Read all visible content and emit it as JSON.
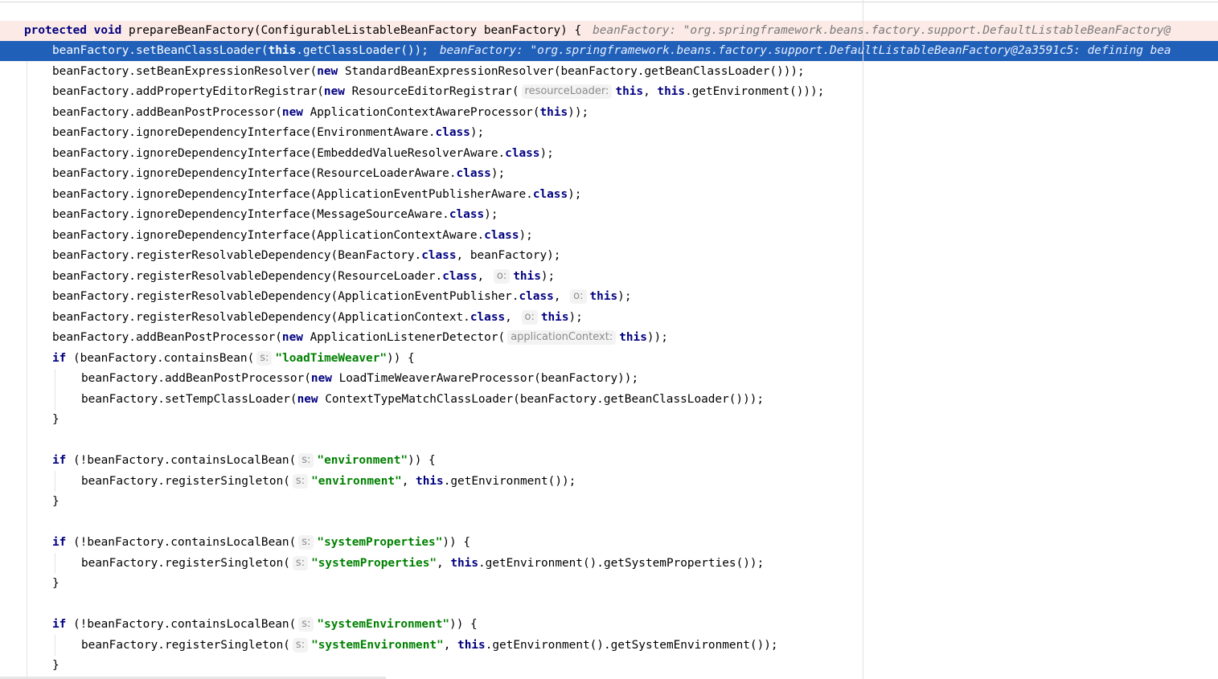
{
  "editor": {
    "method_signature": {
      "kw_protected": "protected",
      "kw_void": "void",
      "text": " prepareBeanFactory(ConfigurableListableBeanFactory beanFactory) {",
      "inline_value": "beanFactory: \"org.springframework.beans.factory.support.DefaultListableBeanFactory@"
    },
    "lines": {
      "l1": {
        "a": "beanFactory.setBeanClassLoader(",
        "kw1": "this",
        "b": ".getClassLoader());",
        "inline_value": "beanFactory: \"org.springframework.beans.factory.support.DefaultListableBeanFactory@2a3591c5: defining bea"
      },
      "l2": {
        "a": "beanFactory.setBeanExpressionResolver(",
        "kw1": "new",
        "b": " StandardBeanExpressionResolver(beanFactory.getBeanClassLoader()));"
      },
      "l3": {
        "a": "beanFactory.addPropertyEditorRegistrar(",
        "kw1": "new",
        "b": " ResourceEditorRegistrar(",
        "hint": "resourceLoader:",
        "kw2": "this",
        "c": ", ",
        "kw3": "this",
        "d": ".getEnvironment()));"
      },
      "l4": {
        "a": "beanFactory.addBeanPostProcessor(",
        "kw1": "new",
        "b": " ApplicationContextAwareProcessor(",
        "kw2": "this",
        "c": "));"
      },
      "l5": {
        "a": "beanFactory.ignoreDependencyInterface(EnvironmentAware.",
        "kw1": "class",
        "b": ");"
      },
      "l6": {
        "a": "beanFactory.ignoreDependencyInterface(EmbeddedValueResolverAware.",
        "kw1": "class",
        "b": ");"
      },
      "l7": {
        "a": "beanFactory.ignoreDependencyInterface(ResourceLoaderAware.",
        "kw1": "class",
        "b": ");"
      },
      "l8": {
        "a": "beanFactory.ignoreDependencyInterface(ApplicationEventPublisherAware.",
        "kw1": "class",
        "b": ");"
      },
      "l9": {
        "a": "beanFactory.ignoreDependencyInterface(MessageSourceAware.",
        "kw1": "class",
        "b": ");"
      },
      "l10": {
        "a": "beanFactory.ignoreDependencyInterface(ApplicationContextAware.",
        "kw1": "class",
        "b": ");"
      },
      "l11": {
        "a": "beanFactory.registerResolvableDependency(BeanFactory.",
        "kw1": "class",
        "b": ", beanFactory);"
      },
      "l12": {
        "a": "beanFactory.registerResolvableDependency(ResourceLoader.",
        "kw1": "class",
        "b": ",",
        "hint": "o:",
        "kw2": "this",
        "c": ");"
      },
      "l13": {
        "a": "beanFactory.registerResolvableDependency(ApplicationEventPublisher.",
        "kw1": "class",
        "b": ",",
        "hint": "o:",
        "kw2": "this",
        "c": ");"
      },
      "l14": {
        "a": "beanFactory.registerResolvableDependency(ApplicationContext.",
        "kw1": "class",
        "b": ",",
        "hint": "o:",
        "kw2": "this",
        "c": ");"
      },
      "l15": {
        "a": "beanFactory.addBeanPostProcessor(",
        "kw1": "new",
        "b": " ApplicationListenerDetector(",
        "hint": "applicationContext:",
        "kw2": "this",
        "c": "));"
      },
      "l16": {
        "kw1": "if",
        "a": " (beanFactory.containsBean(",
        "hint": "s:",
        "str": "\"loadTimeWeaver\"",
        "b": ")) {"
      },
      "l17": {
        "a": "beanFactory.addBeanPostProcessor(",
        "kw1": "new",
        "b": " LoadTimeWeaverAwareProcessor(beanFactory));"
      },
      "l18": {
        "a": "beanFactory.setTempClassLoader(",
        "kw1": "new",
        "b": " ContextTypeMatchClassLoader(beanFactory.getBeanClassLoader()));"
      },
      "l19": {
        "a": "}"
      },
      "l21": {
        "kw1": "if",
        "a": " (!beanFactory.containsLocalBean(",
        "hint": "s:",
        "str": "\"environment\"",
        "b": ")) {"
      },
      "l22": {
        "a": "beanFactory.registerSingleton(",
        "hint": "s:",
        "str": "\"environment\"",
        "b": ", ",
        "kw1": "this",
        "c": ".getEnvironment());"
      },
      "l23": {
        "a": "}"
      },
      "l25": {
        "kw1": "if",
        "a": " (!beanFactory.containsLocalBean(",
        "hint": "s:",
        "str": "\"systemProperties\"",
        "b": ")) {"
      },
      "l26": {
        "a": "beanFactory.registerSingleton(",
        "hint": "s:",
        "str": "\"systemProperties\"",
        "b": ", ",
        "kw1": "this",
        "c": ".getEnvironment().getSystemProperties());"
      },
      "l27": {
        "a": "}"
      },
      "l29": {
        "kw1": "if",
        "a": " (!beanFactory.containsLocalBean(",
        "hint": "s:",
        "str": "\"systemEnvironment\"",
        "b": ")) {"
      },
      "l30": {
        "a": "beanFactory.registerSingleton(",
        "hint": "s:",
        "str": "\"systemEnvironment\"",
        "b": ", ",
        "kw1": "this",
        "c": ".getEnvironment().getSystemEnvironment());"
      },
      "l31": {
        "a": "}"
      }
    }
  }
}
